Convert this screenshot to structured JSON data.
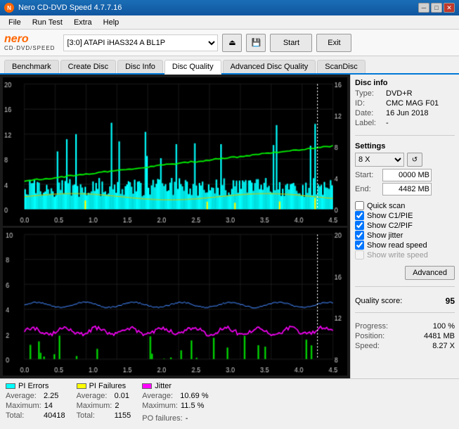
{
  "window": {
    "title": "Nero CD-DVD Speed 4.7.7.16",
    "icon": "●"
  },
  "titlebar": {
    "minimize": "─",
    "maximize": "□",
    "close": "✕"
  },
  "menu": {
    "items": [
      "File",
      "Run Test",
      "Extra",
      "Help"
    ]
  },
  "toolbar": {
    "device": "[3:0]  ATAPI iHAS324  A BL1P",
    "start_label": "Start",
    "exit_label": "Exit"
  },
  "tabs": [
    {
      "label": "Benchmark",
      "active": false
    },
    {
      "label": "Create Disc",
      "active": false
    },
    {
      "label": "Disc Info",
      "active": false
    },
    {
      "label": "Disc Quality",
      "active": true
    },
    {
      "label": "Advanced Disc Quality",
      "active": false
    },
    {
      "label": "ScanDisc",
      "active": false
    }
  ],
  "disc_info": {
    "section": "Disc info",
    "type_label": "Type:",
    "type_value": "DVD+R",
    "id_label": "ID:",
    "id_value": "CMC MAG F01",
    "date_label": "Date:",
    "date_value": "16 Jun 2018",
    "label_label": "Label:",
    "label_value": "-"
  },
  "settings": {
    "section": "Settings",
    "speed": "8 X",
    "start_label": "Start:",
    "start_value": "0000 MB",
    "end_label": "End:",
    "end_value": "4482 MB"
  },
  "checkboxes": {
    "quick_scan": {
      "label": "Quick scan",
      "checked": false
    },
    "show_c1pie": {
      "label": "Show C1/PIE",
      "checked": true
    },
    "show_c2pif": {
      "label": "Show C2/PIF",
      "checked": true
    },
    "show_jitter": {
      "label": "Show jitter",
      "checked": true
    },
    "show_read_speed": {
      "label": "Show read speed",
      "checked": true
    },
    "show_write_speed": {
      "label": "Show write speed",
      "checked": false
    }
  },
  "advanced_btn": "Advanced",
  "quality": {
    "score_label": "Quality score:",
    "score_value": "95"
  },
  "progress": {
    "progress_label": "Progress:",
    "progress_value": "100 %",
    "position_label": "Position:",
    "position_value": "4481 MB",
    "speed_label": "Speed:",
    "speed_value": "8.27 X"
  },
  "legend": {
    "pi_errors": {
      "label": "PI Errors",
      "color": "#00ffff",
      "avg_label": "Average:",
      "avg_value": "2.25",
      "max_label": "Maximum:",
      "max_value": "14",
      "total_label": "Total:",
      "total_value": "40418"
    },
    "pi_failures": {
      "label": "PI Failures",
      "color": "#ffff00",
      "avg_label": "Average:",
      "avg_value": "0.01",
      "max_label": "Maximum:",
      "max_value": "2",
      "total_label": "Total:",
      "total_value": "1155"
    },
    "jitter": {
      "label": "Jitter",
      "color": "#ff00ff",
      "avg_label": "Average:",
      "avg_value": "10.69 %",
      "max_label": "Maximum:",
      "max_value": "11.5 %"
    },
    "po_failures": {
      "label": "PO failures:",
      "value": "-"
    }
  }
}
